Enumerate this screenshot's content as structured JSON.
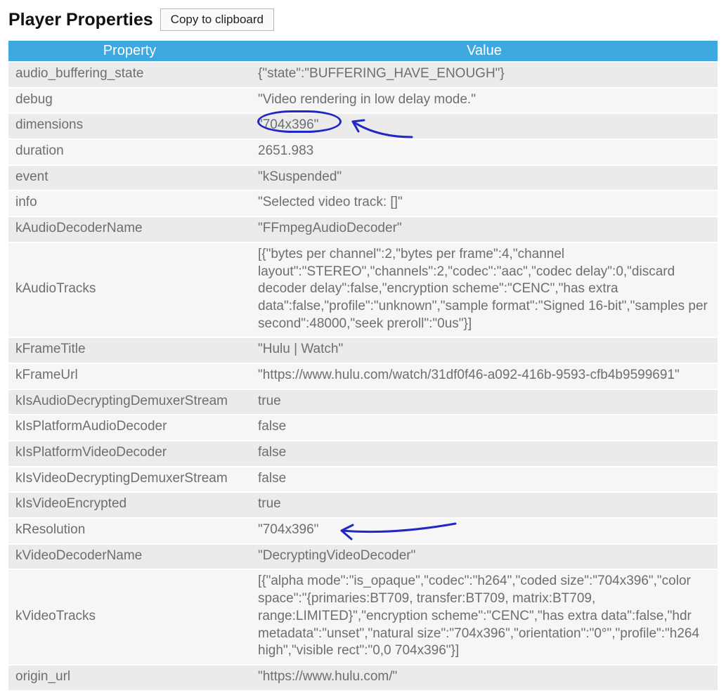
{
  "header": {
    "title": "Player Properties",
    "copy_button": "Copy to clipboard"
  },
  "table": {
    "col_property": "Property",
    "col_value": "Value",
    "rows": [
      {
        "property": "audio_buffering_state",
        "value": "{\"state\":\"BUFFERING_HAVE_ENOUGH\"}"
      },
      {
        "property": "debug",
        "value": "\"Video rendering in low delay mode.\""
      },
      {
        "property": "dimensions",
        "value": "\"704x396\""
      },
      {
        "property": "duration",
        "value": "2651.983"
      },
      {
        "property": "event",
        "value": "\"kSuspended\""
      },
      {
        "property": "info",
        "value": "\"Selected video track: []\""
      },
      {
        "property": "kAudioDecoderName",
        "value": "\"FFmpegAudioDecoder\""
      },
      {
        "property": "kAudioTracks",
        "value": "[{\"bytes per channel\":2,\"bytes per frame\":4,\"channel layout\":\"STEREO\",\"channels\":2,\"codec\":\"aac\",\"codec delay\":0,\"discard decoder delay\":false,\"encryption scheme\":\"CENC\",\"has extra data\":false,\"profile\":\"unknown\",\"sample format\":\"Signed 16-bit\",\"samples per second\":48000,\"seek preroll\":\"0us\"}]"
      },
      {
        "property": "kFrameTitle",
        "value": "\"Hulu | Watch\""
      },
      {
        "property": "kFrameUrl",
        "value": "\"https://www.hulu.com/watch/31df0f46-a092-416b-9593-cfb4b9599691\""
      },
      {
        "property": "kIsAudioDecryptingDemuxerStream",
        "value": "true"
      },
      {
        "property": "kIsPlatformAudioDecoder",
        "value": "false"
      },
      {
        "property": "kIsPlatformVideoDecoder",
        "value": "false"
      },
      {
        "property": "kIsVideoDecryptingDemuxerStream",
        "value": "false"
      },
      {
        "property": "kIsVideoEncrypted",
        "value": "true"
      },
      {
        "property": "kResolution",
        "value": "\"704x396\""
      },
      {
        "property": "kVideoDecoderName",
        "value": "\"DecryptingVideoDecoder\""
      },
      {
        "property": "kVideoTracks",
        "value": "[{\"alpha mode\":\"is_opaque\",\"codec\":\"h264\",\"coded size\":\"704x396\",\"color space\":\"{primaries:BT709, transfer:BT709, matrix:BT709, range:LIMITED}\",\"encryption scheme\":\"CENC\",\"has extra data\":false,\"hdr metadata\":\"unset\",\"natural size\":\"704x396\",\"orientation\":\"0°\",\"profile\":\"h264 high\",\"visible rect\":\"0,0 704x396\"}]"
      },
      {
        "property": "origin_url",
        "value": "\"https://www.hulu.com/\""
      }
    ]
  }
}
